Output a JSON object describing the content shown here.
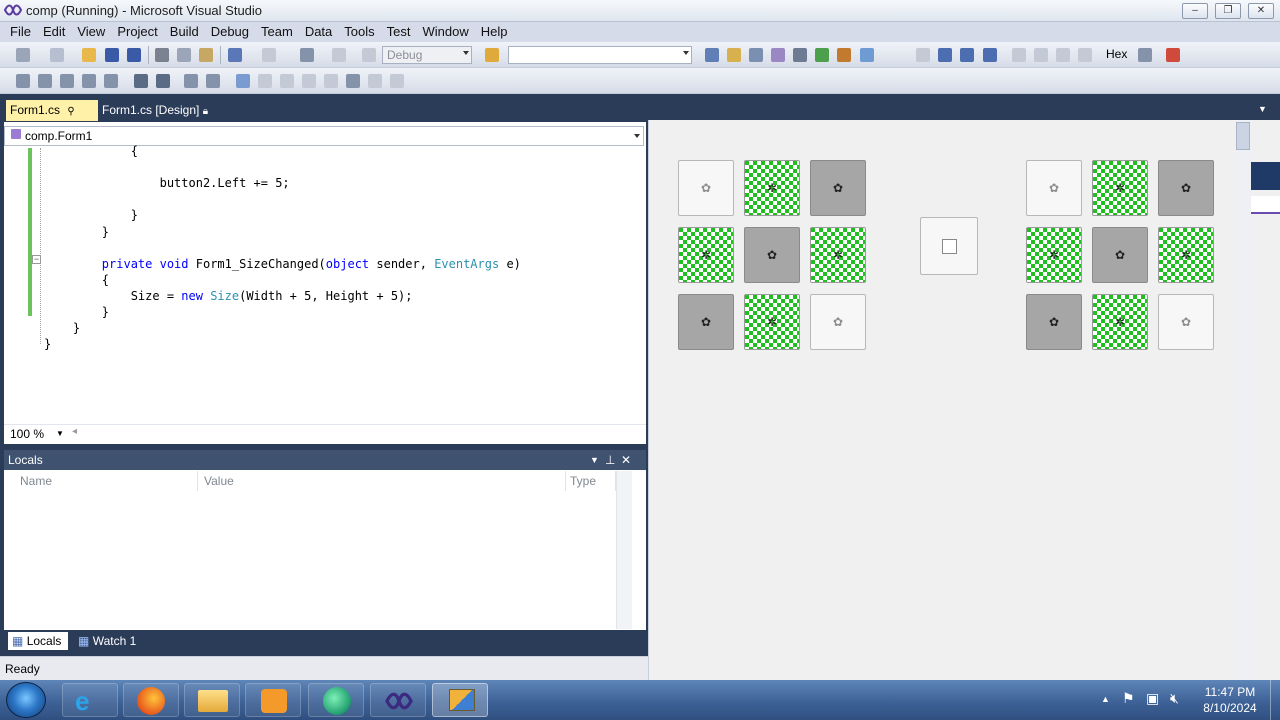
{
  "window": {
    "title": "comp (Running) - Microsoft Visual Studio"
  },
  "menu": [
    "File",
    "Edit",
    "View",
    "Project",
    "Build",
    "Debug",
    "Team",
    "Data",
    "Tools",
    "Test",
    "Window",
    "Help"
  ],
  "toolbar": {
    "config": "Debug",
    "platform": "",
    "hex_label": "Hex"
  },
  "tabs": [
    {
      "label": "Form1.cs"
    },
    {
      "label": "Form1.cs [Design]"
    }
  ],
  "navbar": {
    "class_name": "comp.Form1"
  },
  "code": {
    "lines": [
      {
        "indent": "            ",
        "parts": [
          {
            "t": "{",
            "c": ""
          }
        ]
      },
      {
        "indent": "",
        "parts": [
          {
            "t": "",
            "c": ""
          }
        ]
      },
      {
        "indent": "                ",
        "parts": [
          {
            "t": "button2.Left += 5;",
            "c": ""
          }
        ]
      },
      {
        "indent": "",
        "parts": [
          {
            "t": "",
            "c": ""
          }
        ]
      },
      {
        "indent": "            ",
        "parts": [
          {
            "t": "}",
            "c": ""
          }
        ]
      },
      {
        "indent": "        ",
        "parts": [
          {
            "t": "}",
            "c": ""
          }
        ]
      },
      {
        "indent": "",
        "parts": [
          {
            "t": "",
            "c": ""
          }
        ]
      },
      {
        "indent": "        ",
        "parts": [
          {
            "t": "private",
            "c": "kw"
          },
          {
            "t": " ",
            "c": ""
          },
          {
            "t": "void",
            "c": "kw"
          },
          {
            "t": " Form1_SizeChanged(",
            "c": ""
          },
          {
            "t": "object",
            "c": "kw"
          },
          {
            "t": " sender, ",
            "c": ""
          },
          {
            "t": "EventArgs",
            "c": "ty"
          },
          {
            "t": " e)",
            "c": ""
          }
        ]
      },
      {
        "indent": "        ",
        "parts": [
          {
            "t": "{",
            "c": ""
          }
        ]
      },
      {
        "indent": "            ",
        "parts": [
          {
            "t": "Size = ",
            "c": ""
          },
          {
            "t": "new",
            "c": "kw"
          },
          {
            "t": " ",
            "c": ""
          },
          {
            "t": "Size",
            "c": "ty"
          },
          {
            "t": "(Width + 5, Height + 5);",
            "c": ""
          }
        ]
      },
      {
        "indent": "        ",
        "parts": [
          {
            "t": "}",
            "c": ""
          }
        ]
      },
      {
        "indent": "    ",
        "parts": [
          {
            "t": "}",
            "c": ""
          }
        ]
      },
      {
        "indent": "",
        "parts": [
          {
            "t": "}",
            "c": ""
          }
        ]
      }
    ]
  },
  "zoom": "100 %",
  "locals": {
    "title": "Locals",
    "columns": [
      "Name",
      "Value",
      "Type"
    ],
    "rows": []
  },
  "bottom_tabs": [
    {
      "label": "Locals"
    },
    {
      "label": "Watch 1"
    }
  ],
  "status": {
    "text": "Ready"
  },
  "game": {
    "left_grid": [
      "light",
      "check",
      "gray",
      "check",
      "gray",
      "check",
      "gray",
      "check",
      "light"
    ],
    "right_grid": [
      "light",
      "check",
      "gray",
      "check",
      "gray",
      "check",
      "gray",
      "check",
      "light"
    ]
  },
  "clock": {
    "time": "11:47 PM",
    "date": "8/10/2024"
  },
  "taskbar": {
    "apps": [
      "Internet Explorer",
      "Firefox",
      "File Explorer",
      "Media Player",
      "App",
      "Visual Studio",
      "Running App"
    ]
  }
}
